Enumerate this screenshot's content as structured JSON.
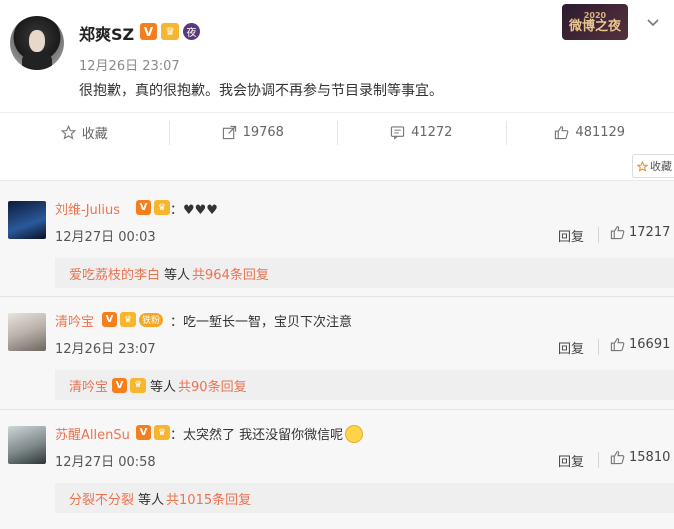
{
  "post": {
    "username": "郑爽SZ",
    "badge_v": "V",
    "badge_night": "夜",
    "time": "12月26日 23:07",
    "text": "很抱歉，真的很抱歉。我会协调不再参与节目录制等事宜。",
    "event_logo": "微博之夜",
    "event_year": "2020"
  },
  "actions": {
    "favorite_label": "收藏",
    "repost_count": "19768",
    "comment_count": "41272",
    "like_count": "481129"
  },
  "fav_tag_label": "收藏",
  "comments": [
    {
      "name": "刘维-Julius",
      "text": "：♥♥♥",
      "time": "12月27日 00:03",
      "reply_label": "回复",
      "likes": "17217",
      "sub_who": "爱吃荔枝的李白",
      "sub_deng": "等人",
      "sub_count": "共964条回复"
    },
    {
      "name": "清吟宝",
      "fan_badge": "铁粉",
      "text": "：吃一堑长一智，宝贝下次注意",
      "time": "12月26日 23:07",
      "reply_label": "回复",
      "likes": "16691",
      "sub_who": "清吟宝",
      "sub_deng": "等人",
      "sub_count": "共90条回复"
    },
    {
      "name": "苏醒AllenSu",
      "text": "：太突然了 我还没留你微信呢",
      "time": "12月27日 00:58",
      "reply_label": "回复",
      "likes": "15810",
      "sub_who": "分裂不分裂",
      "sub_deng": "等人",
      "sub_count": "共1015条回复"
    }
  ],
  "colors": {
    "name_orange": "#eb7350",
    "v_badge": "#f57f1c",
    "crown": "#f8b52e"
  }
}
